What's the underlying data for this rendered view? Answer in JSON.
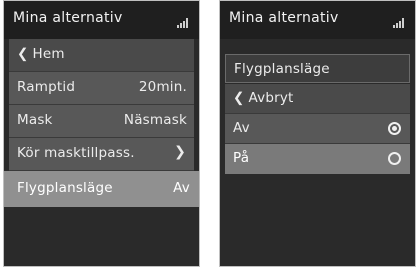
{
  "left": {
    "title": "Mina alternativ",
    "back_label": "Hem",
    "items": [
      {
        "label": "Ramptid",
        "value": "20min."
      },
      {
        "label": "Mask",
        "value": "Näsmask"
      },
      {
        "label": "Kör masktillpass.",
        "value": ""
      },
      {
        "label": "Flygplansläge",
        "value": "Av"
      }
    ]
  },
  "right": {
    "title": "Mina alternativ",
    "header": "Flygplansläge",
    "cancel_label": "Avbryt",
    "options": [
      {
        "label": "Av",
        "checked": true
      },
      {
        "label": "På",
        "checked": false
      }
    ]
  },
  "icons": {
    "back": "chevron-left-icon",
    "forward": "chevron-right-icon",
    "signal": "signal-strength-icon",
    "radio_on": "radio-checked-icon",
    "radio_off": "radio-unchecked-icon"
  }
}
